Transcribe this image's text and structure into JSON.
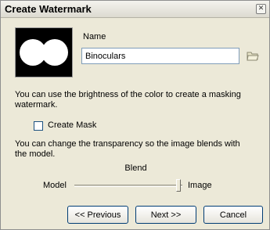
{
  "window": {
    "title": "Create Watermark",
    "close_glyph": "✕"
  },
  "preview": {
    "icon": "binoculars-mask-preview"
  },
  "name": {
    "label": "Name",
    "value": "Binoculars",
    "browse_icon": "folder-open-icon"
  },
  "mask": {
    "description": "You can use the brightness of the color to create a masking watermark.",
    "checkbox_label": "Create Mask",
    "checked": false
  },
  "blend": {
    "description": "You can change the transparency so the image blends with the  model.",
    "label": "Blend",
    "left_label": "Model",
    "right_label": "Image",
    "level": 1.0
  },
  "buttons": {
    "previous": "<< Previous",
    "next": "Next >>",
    "cancel": "Cancel"
  },
  "colors": {
    "dialog_bg": "#ece9d8",
    "button_border": "#003c74",
    "input_border": "#7f9db9"
  }
}
